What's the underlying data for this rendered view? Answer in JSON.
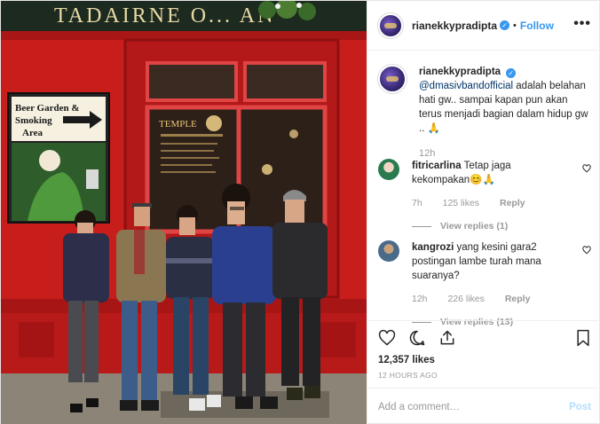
{
  "header": {
    "username": "rianekkypradipta",
    "verified_mark": "✓",
    "separator": "•",
    "follow_label": "Follow",
    "more_label": "•••"
  },
  "photo": {
    "sign_text": "TADAIRNE O... AN",
    "poster_text_1": "Beer Garden &",
    "poster_text_2": "Smoking",
    "poster_text_3": "Area",
    "window_text": "TEMPLE"
  },
  "caption": {
    "username": "rianekkypradipta",
    "mention": "@dmasivbandofficial",
    "text": " adalah belahan hati gw.. sampai kapan pun akan terus menjadi bagian dalam hidup gw .. 🙏",
    "time": "12h"
  },
  "comments": [
    {
      "username": "fitricarlina",
      "text": " Tetap jaga kekompakan😊🙏",
      "time": "7h",
      "likes": "125 likes",
      "reply_label": "Reply",
      "view_replies": "View replies (1)"
    },
    {
      "username": "kangrozi",
      "text": " yang kesini gara2 postingan lambe turah mana suaranya?",
      "time": "12h",
      "likes": "226 likes",
      "reply_label": "Reply",
      "view_replies": "View replies (13)"
    }
  ],
  "actions": {
    "likes_count": "12,357 likes",
    "time_ago": "12 HOURS AGO",
    "icons": [
      "heart-icon",
      "comment-icon",
      "share-icon",
      "bookmark-icon"
    ]
  },
  "add_comment": {
    "placeholder": "Add a comment…",
    "post_label": "Post"
  },
  "colors": {
    "accent": "#3897f0",
    "mention": "#003569",
    "muted": "#999999",
    "storefront_red": "#c61c1c",
    "post_disabled": "#b2dffc"
  }
}
